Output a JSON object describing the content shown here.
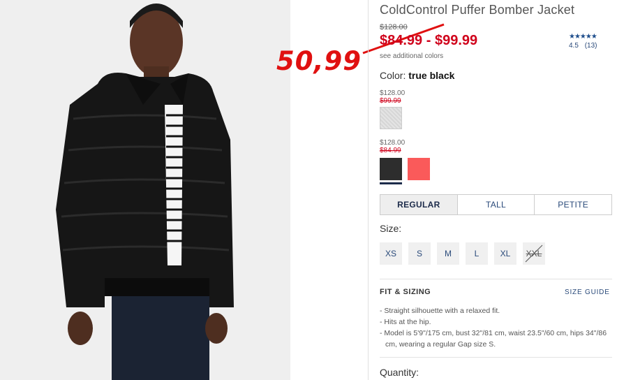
{
  "product": {
    "title": "ColdControl Puffer Bomber Jacket",
    "original_price": "$128.00",
    "sale_price_range": "$84.99 - $99.99",
    "see_colors": "see additional colors",
    "rating": {
      "stars": "★★★★★",
      "score": "4.5",
      "count": "(13)",
      "value": 4.5
    }
  },
  "annotation": {
    "price": "50,99",
    "color": "#e01010"
  },
  "color": {
    "label": "Color:",
    "value": "true black"
  },
  "swatch_groups": [
    {
      "original": "$128.00",
      "sale": "$99.99"
    },
    {
      "original": "$128.00",
      "sale": "$84.99"
    }
  ],
  "fit_tabs": [
    {
      "label": "REGULAR",
      "active": true
    },
    {
      "label": "TALL",
      "active": false
    },
    {
      "label": "PETITE",
      "active": false
    }
  ],
  "size": {
    "label": "Size:",
    "options": [
      "XS",
      "S",
      "M",
      "L",
      "XL",
      "XXL"
    ],
    "unavailable": [
      "XXL"
    ]
  },
  "fit_sizing": {
    "heading": "FIT & SIZING",
    "guide_link": "SIZE GUIDE",
    "bullets": [
      "Straight silhouette with a relaxed fit.",
      "Hits at the hip.",
      "Model is 5'9\"/175 cm, bust 32\"/81 cm, waist 23.5\"/60 cm, hips 34\"/86 cm, wearing a regular Gap size S."
    ]
  },
  "quantity": {
    "label": "Quantity:"
  },
  "colors": {
    "sale_red": "#d0021b",
    "link_blue": "#2a4a7a",
    "swatch_black": "#2d2d2d",
    "swatch_coral": "#fa5a5a"
  }
}
